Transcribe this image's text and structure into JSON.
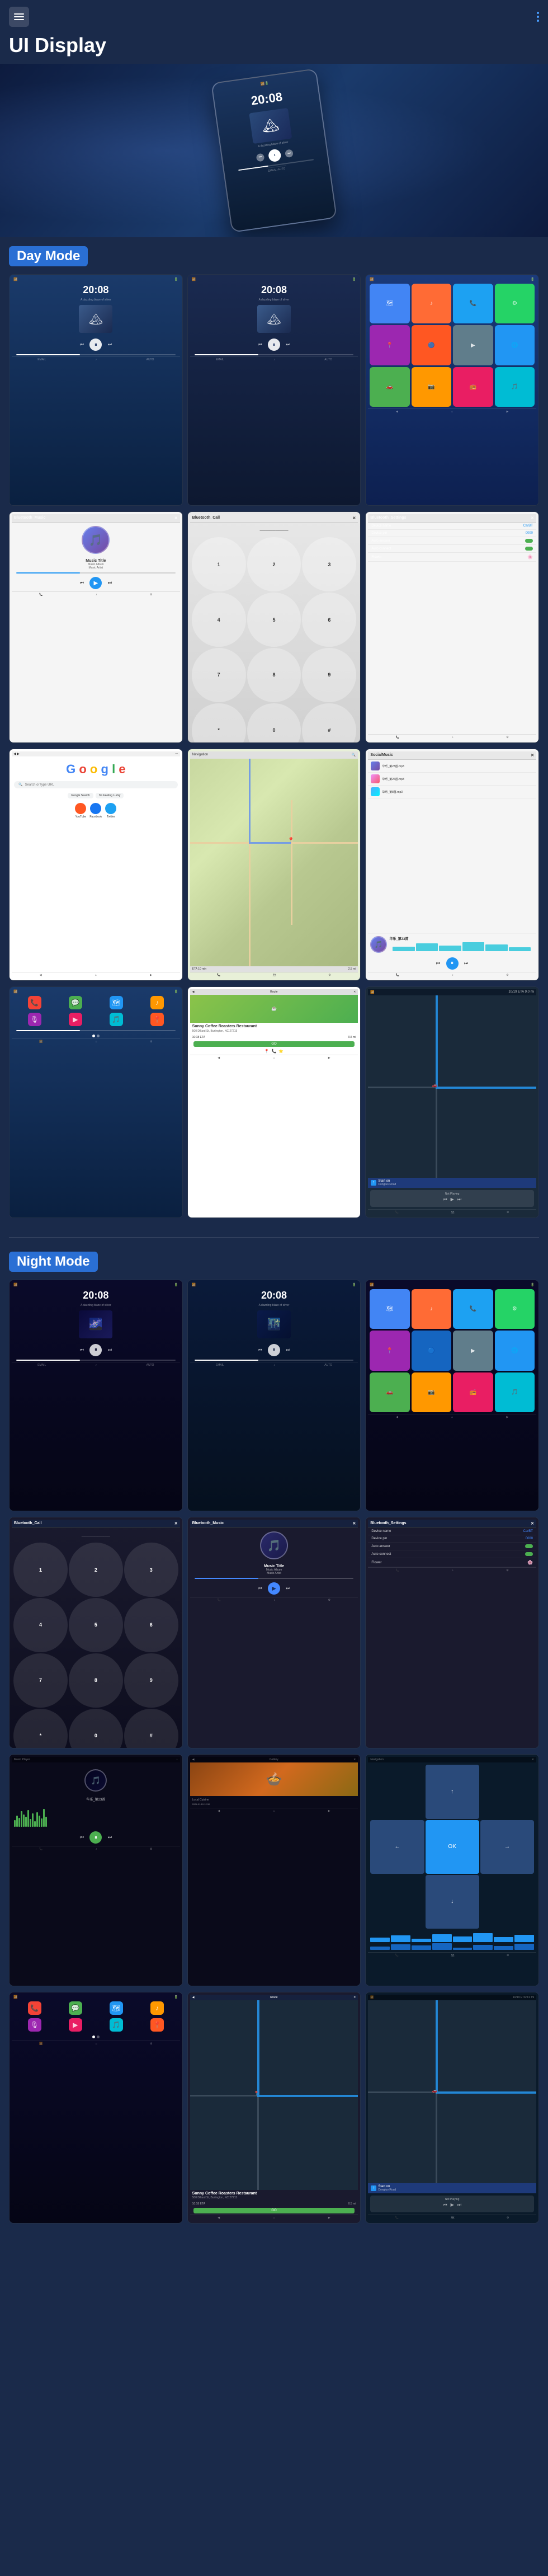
{
  "header": {
    "title": "UI Display",
    "menu_label": "menu",
    "nav_icon": "navigation"
  },
  "day_mode": {
    "label": "Day Mode"
  },
  "night_mode": {
    "label": "Night Mode"
  },
  "music": {
    "title": "Music Title",
    "album": "Music Album",
    "artist": "Music Artist",
    "time": "20:08",
    "subtitle": "A dazzling blaze of silver"
  },
  "bluetooth": {
    "device_name_label": "Device name",
    "device_name_value": "CarBT",
    "device_pin_label": "Device pin",
    "device_pin_value": "0000",
    "auto_answer_label": "Auto answer",
    "auto_connect_label": "Auto connect",
    "flower_label": "Flower"
  },
  "nav": {
    "eta": "10/19 ETA  9.0 mi",
    "start_on": "Start on",
    "destination": "Dongluo Road",
    "not_playing": "Not Playing"
  },
  "restaurant": {
    "name": "Sunny Coffee Roasters Restaurant",
    "address": "500 Dillard St, Burlington, NC 27215",
    "eta": "10:18 ETA",
    "distance": "0.5 mi",
    "go_label": "GO"
  },
  "icons": {
    "menu": "☰",
    "music_note": "♪",
    "play": "▶",
    "pause": "⏸",
    "prev": "⏮",
    "next": "⏭",
    "phone": "📞",
    "map": "🗺",
    "settings": "⚙",
    "home": "⌂",
    "back": "◀",
    "forward": "▶",
    "search": "🔍",
    "coffee": "☕",
    "music_disc": "💿",
    "waze": "📍",
    "arrow_up": "↑",
    "arrow_left": "←",
    "arrow_right": "→",
    "arrow_down": "↓"
  },
  "google": {
    "search_placeholder": "Search or type URL"
  },
  "local_music": {
    "file1": "华乐_第23首.mp3",
    "file2": "华乐_第26首.mp3",
    "file3": "华乐_第8首.mp3"
  }
}
